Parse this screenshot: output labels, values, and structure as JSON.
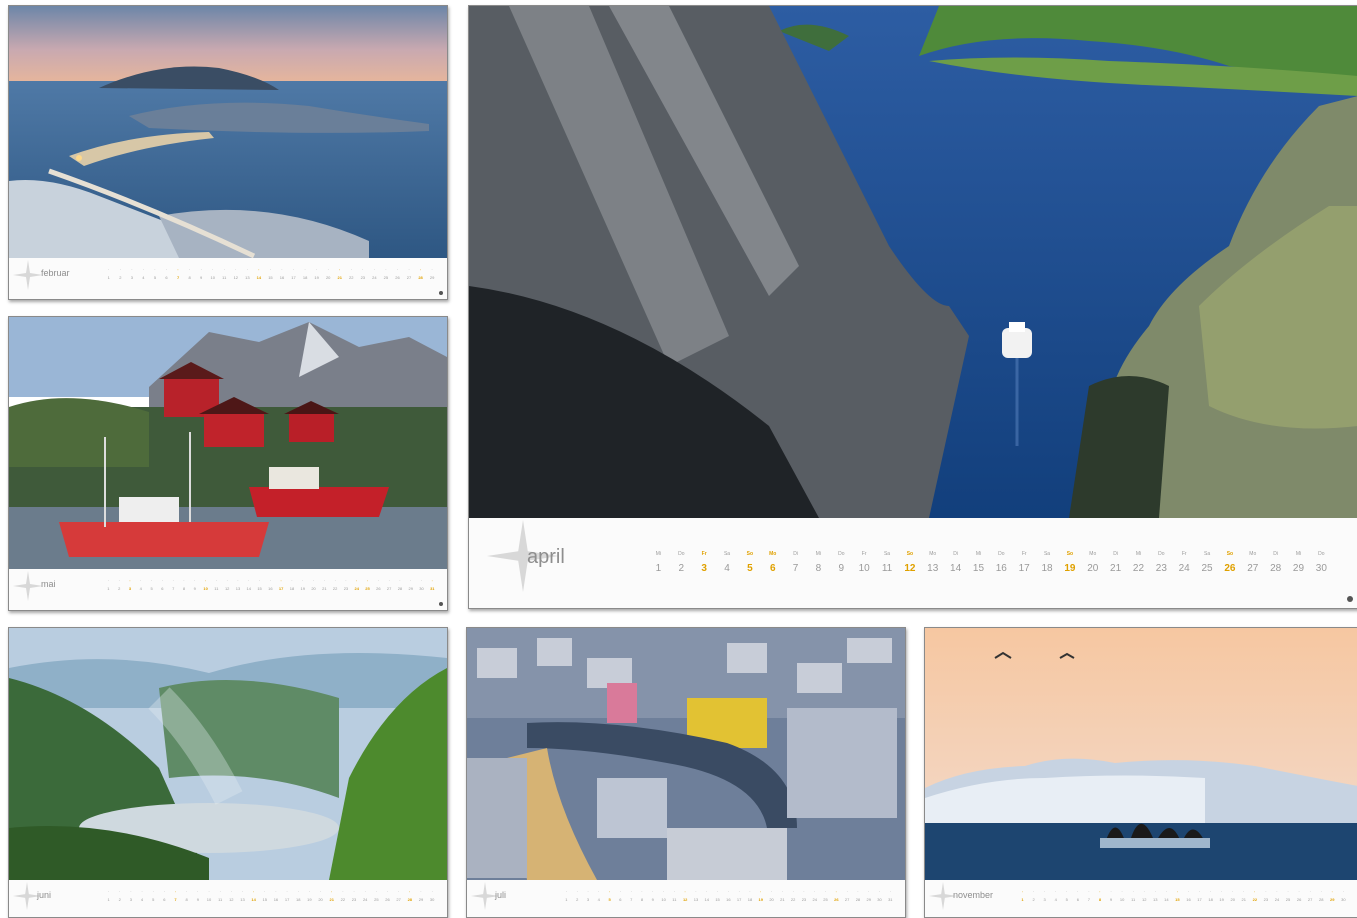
{
  "colors": {
    "highlight": "#e0a100",
    "text": "#9a9a9a",
    "border": "#8a8a8a"
  },
  "pages": {
    "februar": {
      "month": "februar",
      "days": [
        "1",
        "2",
        "3",
        "4",
        "5",
        "6",
        "7",
        "8",
        "9",
        "10",
        "11",
        "12",
        "13",
        "14",
        "15",
        "16",
        "17",
        "18",
        "19",
        "20",
        "21",
        "22",
        "23",
        "24",
        "25",
        "26",
        "27",
        "28",
        "29"
      ],
      "highlight": [
        "7",
        "14",
        "21",
        "28"
      ]
    },
    "mai": {
      "month": "mai",
      "days": [
        "1",
        "2",
        "3",
        "4",
        "5",
        "6",
        "7",
        "8",
        "9",
        "10",
        "11",
        "12",
        "13",
        "14",
        "15",
        "16",
        "17",
        "18",
        "19",
        "20",
        "21",
        "22",
        "23",
        "24",
        "25",
        "26",
        "27",
        "28",
        "29",
        "30",
        "31"
      ],
      "highlight": [
        "3",
        "10",
        "17",
        "24",
        "25",
        "31"
      ]
    },
    "april": {
      "month": "april",
      "weekdays": [
        "Mi",
        "Do",
        "Fr",
        "Sa",
        "So",
        "Mo",
        "Di",
        "Mi",
        "Do",
        "Fr",
        "Sa",
        "So",
        "Mo",
        "Di",
        "Mi",
        "Do",
        "Fr",
        "Sa",
        "So",
        "Mo",
        "Di",
        "Mi",
        "Do",
        "Fr",
        "Sa",
        "So",
        "Mo",
        "Di",
        "Mi",
        "Do"
      ],
      "days": [
        "1",
        "2",
        "3",
        "4",
        "5",
        "6",
        "7",
        "8",
        "9",
        "10",
        "11",
        "12",
        "13",
        "14",
        "15",
        "16",
        "17",
        "18",
        "19",
        "20",
        "21",
        "22",
        "23",
        "24",
        "25",
        "26",
        "27",
        "28",
        "29",
        "30"
      ],
      "highlight": [
        "3",
        "5",
        "6",
        "12",
        "19",
        "26"
      ]
    },
    "juni": {
      "month": "juni",
      "days": [
        "1",
        "2",
        "3",
        "4",
        "5",
        "6",
        "7",
        "8",
        "9",
        "10",
        "11",
        "12",
        "13",
        "14",
        "15",
        "16",
        "17",
        "18",
        "19",
        "20",
        "21",
        "22",
        "23",
        "24",
        "25",
        "26",
        "27",
        "28",
        "29",
        "30"
      ],
      "highlight": [
        "7",
        "14",
        "21",
        "28"
      ]
    },
    "juli": {
      "month": "juli",
      "days": [
        "1",
        "2",
        "3",
        "4",
        "5",
        "6",
        "7",
        "8",
        "9",
        "10",
        "11",
        "12",
        "13",
        "14",
        "15",
        "16",
        "17",
        "18",
        "19",
        "20",
        "21",
        "22",
        "23",
        "24",
        "25",
        "26",
        "27",
        "28",
        "29",
        "30",
        "31"
      ],
      "highlight": [
        "5",
        "12",
        "19",
        "26"
      ]
    },
    "november": {
      "month": "november",
      "days": [
        "1",
        "2",
        "3",
        "4",
        "5",
        "6",
        "7",
        "8",
        "9",
        "10",
        "11",
        "12",
        "13",
        "14",
        "15",
        "16",
        "17",
        "18",
        "19",
        "20",
        "21",
        "22",
        "23",
        "24",
        "25",
        "26",
        "27",
        "28",
        "29",
        "30"
      ],
      "highlight": [
        "1",
        "8",
        "15",
        "22",
        "29"
      ]
    }
  }
}
